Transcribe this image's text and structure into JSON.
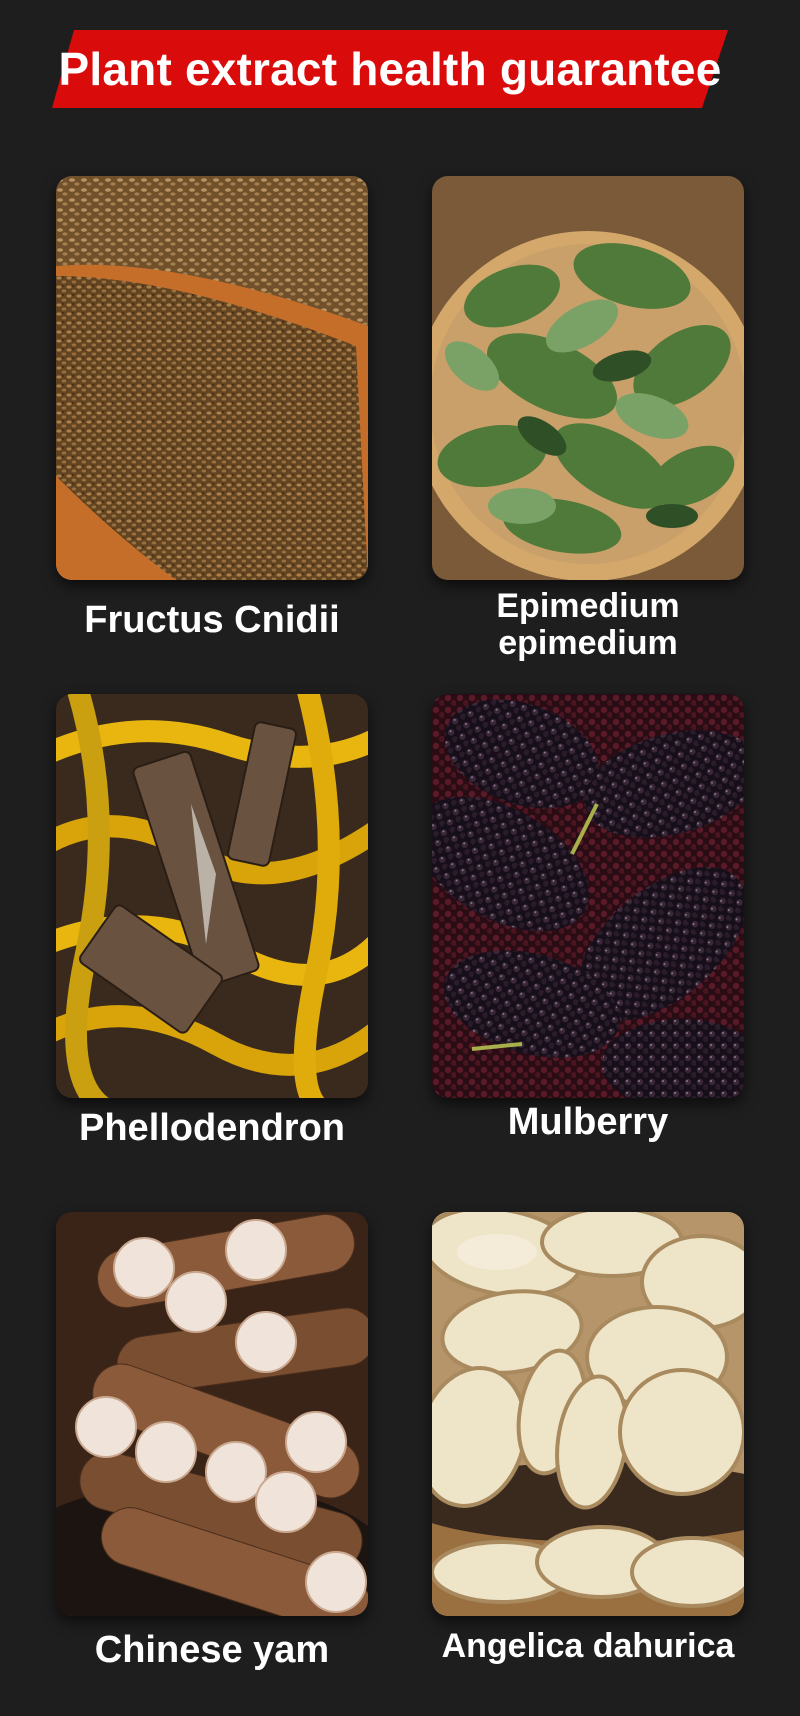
{
  "header": {
    "title": "Plant extract health guarantee",
    "banner_color": "#d90b0b"
  },
  "products": [
    {
      "name": "Fructus Cnidii",
      "image_icon": "cnidium-seeds-icon"
    },
    {
      "name": "Epimedium epimedium",
      "image_icon": "epimedium-leaves-icon"
    },
    {
      "name": "Phellodendron",
      "image_icon": "phellodendron-bark-icon"
    },
    {
      "name": "Mulberry",
      "image_icon": "mulberry-fruit-icon"
    },
    {
      "name": "Chinese yam",
      "image_icon": "chinese-yam-icon"
    },
    {
      "name": "Angelica dahurica",
      "image_icon": "angelica-slices-icon"
    }
  ]
}
